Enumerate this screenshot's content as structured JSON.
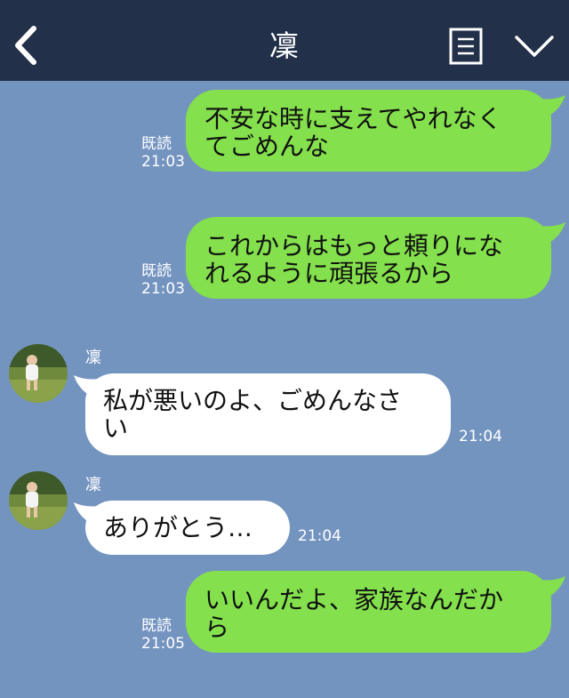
{
  "header": {
    "title": "凜",
    "back_icon": "chevron-left-icon",
    "memo_icon": "note-icon",
    "menu_icon": "chevron-down-icon"
  },
  "colors": {
    "header_bg": "#23304a",
    "chat_bg": "#7494c0",
    "sent_bubble": "#84e04c",
    "received_bubble": "#ffffff"
  },
  "messages": [
    {
      "side": "sent",
      "text": "不安な時に支えてやれなく\nてごめんな",
      "read": "既読",
      "time": "21:03"
    },
    {
      "side": "sent",
      "text": "これからはもっと頼りにな\nれるように頑張るから",
      "read": "既読",
      "time": "21:03"
    },
    {
      "side": "received",
      "sender": "凜",
      "text": "私が悪いのよ、ごめんなさ\nい",
      "time": "21:04"
    },
    {
      "side": "received",
      "sender": "凜",
      "text": "ありがとう…",
      "time": "21:04"
    },
    {
      "side": "sent",
      "text": "いいんだよ、家族なんだか\nら",
      "read": "既読",
      "time": "21:05"
    }
  ]
}
